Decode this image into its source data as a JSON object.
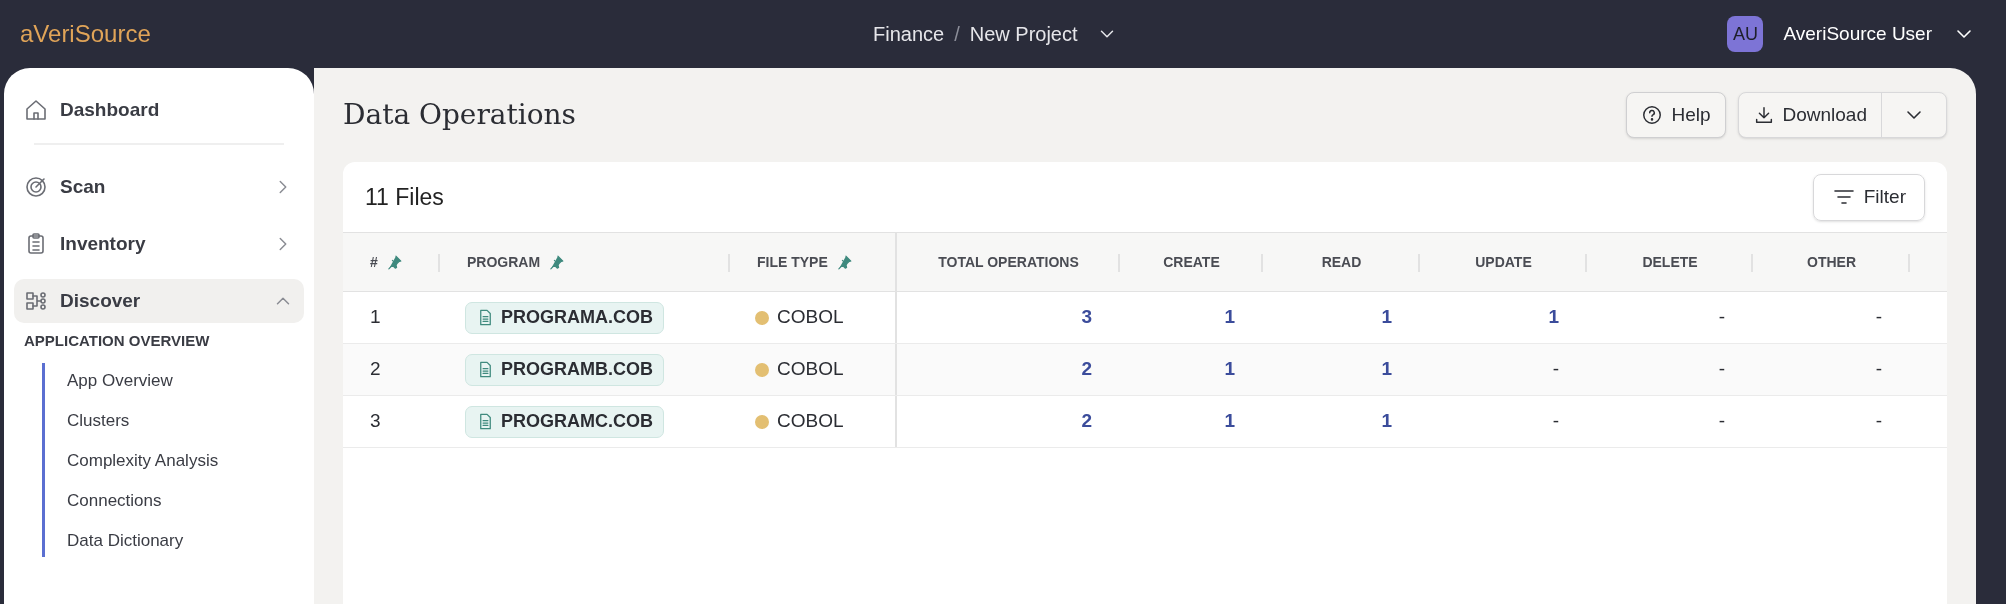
{
  "header": {
    "logo": "aVeriSource",
    "breadcrumb": [
      "Finance",
      "New Project"
    ],
    "breadcrumb_separator": "/",
    "user": {
      "initials": "AU",
      "name": "AveriSource User"
    }
  },
  "sidebar": {
    "items": [
      {
        "label": "Dashboard",
        "kind": "link",
        "selected": false
      },
      {
        "label": "Scan",
        "kind": "group",
        "selected": false,
        "expanded": false
      },
      {
        "label": "Inventory",
        "kind": "group",
        "selected": false,
        "expanded": false
      },
      {
        "label": "Discover",
        "kind": "group",
        "selected": true,
        "expanded": true,
        "section": "APPLICATION OVERVIEW",
        "children": [
          {
            "label": "App Overview"
          },
          {
            "label": "Clusters"
          },
          {
            "label": "Complexity Analysis"
          },
          {
            "label": "Connections"
          },
          {
            "label": "Data Dictionary"
          }
        ]
      }
    ]
  },
  "page": {
    "title": "Data Operations",
    "help_button": "Help",
    "download_button": "Download"
  },
  "table": {
    "count": "11 Files",
    "filter_button": "Filter",
    "columns": [
      {
        "label": "#",
        "pinned": true
      },
      {
        "label": "PROGRAM",
        "pinned": true
      },
      {
        "label": "FILE TYPE",
        "pinned": true
      },
      {
        "label": "TOTAL OPERATIONS",
        "pinned": false
      },
      {
        "label": "CREATE",
        "pinned": false
      },
      {
        "label": "READ",
        "pinned": false
      },
      {
        "label": "UPDATE",
        "pinned": false
      },
      {
        "label": "DELETE",
        "pinned": false
      },
      {
        "label": "OTHER",
        "pinned": false
      }
    ],
    "rows": [
      {
        "number": "1",
        "program": "PROGRAMA.COB",
        "file_type": {
          "label": "COBOL",
          "color": "#e3bf72"
        },
        "values": [
          {
            "text": "3",
            "link": true
          },
          {
            "text": "1",
            "link": true
          },
          {
            "text": "1",
            "link": true
          },
          {
            "text": "1",
            "link": true
          },
          {
            "text": "-",
            "link": false
          },
          {
            "text": "-",
            "link": false
          }
        ]
      },
      {
        "number": "2",
        "program": "PROGRAMB.COB",
        "file_type": {
          "label": "COBOL",
          "color": "#e3bf72"
        },
        "values": [
          {
            "text": "2",
            "link": true
          },
          {
            "text": "1",
            "link": true
          },
          {
            "text": "1",
            "link": true
          },
          {
            "text": "-",
            "link": false
          },
          {
            "text": "-",
            "link": false
          },
          {
            "text": "-",
            "link": false
          }
        ]
      },
      {
        "number": "3",
        "program": "PROGRAMC.COB",
        "file_type": {
          "label": "COBOL",
          "color": "#e3bf72"
        },
        "values": [
          {
            "text": "2",
            "link": true
          },
          {
            "text": "1",
            "link": true
          },
          {
            "text": "1",
            "link": true
          },
          {
            "text": "-",
            "link": false
          },
          {
            "text": "-",
            "link": false
          },
          {
            "text": "-",
            "link": false
          }
        ]
      }
    ]
  }
}
